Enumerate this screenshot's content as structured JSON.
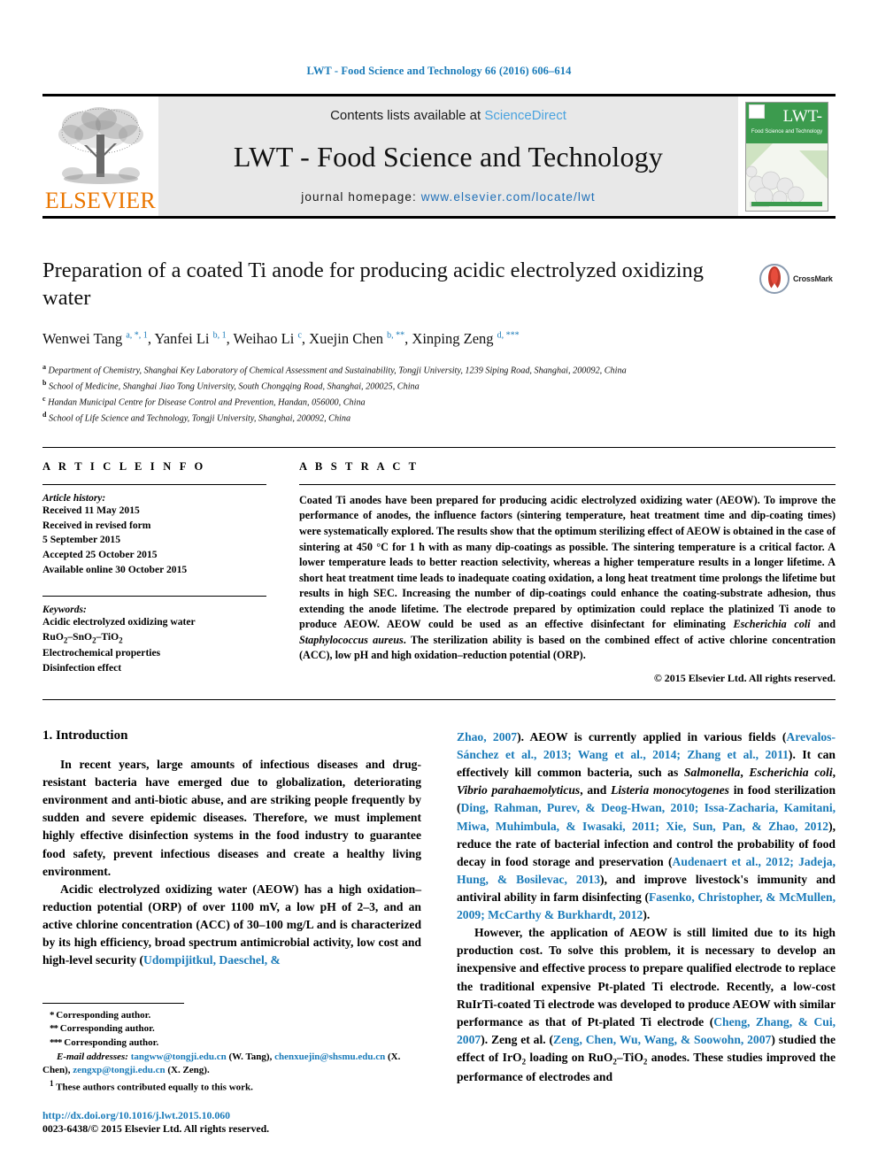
{
  "running_head": "LWT - Food Science and Technology 66 (2016) 606–614",
  "masthead": {
    "publisher_name": "ELSEVIER",
    "contents_prefix": "Contents lists available at ",
    "sciencedirect": "ScienceDirect",
    "journal_title": "LWT - Food Science and Technology",
    "homepage_prefix": "journal homepage: ",
    "homepage_url": "www.elsevier.com/locate/lwt",
    "cover": {
      "title": "LWT-",
      "subtitle": "Food Science and Technology"
    },
    "colors": {
      "link": "#2070b8",
      "sciencedirect": "#4aa3df",
      "elsevier_orange": "#ea7600",
      "band_grey": "#e8e8e8",
      "cover_green": "#3c9b4e"
    }
  },
  "article": {
    "title": "Preparation of a coated Ti anode for producing acidic electrolyzed oxidizing water",
    "crossmark_label": "CrossMark",
    "authors_html": "Wenwei Tang <sup>a, *, 1</sup>, Yanfei Li <sup>b, 1</sup>, Weihao Li <sup>c</sup>, Xuejin Chen <sup>b, **</sup>, Xinping Zeng <sup>d, ***</sup>",
    "affiliations": [
      {
        "mark": "a",
        "text": "Department of Chemistry, Shanghai Key Laboratory of Chemical Assessment and Sustainability, Tongji University, 1239 Siping Road, Shanghai, 200092, China"
      },
      {
        "mark": "b",
        "text": "School of Medicine, Shanghai Jiao Tong University, South Chongqing Road, Shanghai, 200025, China"
      },
      {
        "mark": "c",
        "text": "Handan Municipal Centre for Disease Control and Prevention, Handan, 056000, China"
      },
      {
        "mark": "d",
        "text": "School of Life Science and Technology, Tongji University, Shanghai, 200092, China"
      }
    ]
  },
  "article_info": {
    "heading": "A R T I C L E  I N F O",
    "history_label": "Article history:",
    "history": [
      "Received 11 May 2015",
      "Received in revised form",
      "5 September 2015",
      "Accepted 25 October 2015",
      "Available online 30 October 2015"
    ],
    "keywords_label": "Keywords:",
    "keywords_html": [
      "Acidic electrolyzed oxidizing water",
      "RuO<sub>2</sub>–SnO<sub>2</sub>–TiO<sub>2</sub>",
      "Electrochemical properties",
      "Disinfection effect"
    ]
  },
  "abstract": {
    "heading": "A B S T R A C T",
    "body_html": "Coated Ti anodes have been prepared for producing acidic electrolyzed oxidizing water (AEOW). To improve the performance of anodes, the influence factors (sintering temperature, heat treatment time and dip-coating times) were systematically explored. The results show that the optimum sterilizing effect of AEOW is obtained in the case of sintering at 450 °C for 1 h with as many dip-coatings as possible. The sintering temperature is a critical factor. A lower temperature leads to better reaction selectivity, whereas a higher temperature results in a longer lifetime. A short heat treatment time leads to inadequate coating oxidation, a long heat treatment time prolongs the lifetime but results in high SEC. Increasing the number of dip-coatings could enhance the coating-substrate adhesion, thus extending the anode lifetime. The electrode prepared by optimization could replace the platinized Ti anode to produce AEOW. AEOW could be used as an effective disinfectant for eliminating <i>Escherichia coli</i> and <i>Staphylococcus aureus</i>. The sterilization ability is based on the combined effect of active chlorine concentration (ACC), low pH and high oxidation–reduction potential (ORP).",
    "copyright": "© 2015 Elsevier Ltd. All rights reserved."
  },
  "introduction": {
    "heading": "1.  Introduction",
    "left_paragraphs_html": [
      "In recent years, large amounts of infectious diseases and drug-resistant bacteria have emerged due to globalization, deteriorating environment and anti-biotic abuse, and are striking people frequently by sudden and severe epidemic diseases. Therefore, we must implement highly effective disinfection systems in the food industry to guarantee food safety, prevent infectious diseases and create a healthy living environment.",
      "Acidic electrolyzed oxidizing water (AEOW) has a high oxidation–reduction potential (ORP) of over 1100 mV, a low pH of 2–3, and an active chlorine concentration (ACC) of 30–100 mg/L and is characterized by its high efficiency, broad spectrum antimicrobial activity, low cost and high-level security (<span class=\"ref\">Udompijitkul, Daeschel, &amp;</span>"
    ],
    "right_paragraphs_html": [
      "<span class=\"ref\">Zhao, 2007</span>). AEOW is currently applied in various fields (<span class=\"ref\">Arevalos-Sánchez et al., 2013; Wang et al., 2014; Zhang et al., 2011</span>). It can effectively kill common bacteria, such as <i>Salmonella</i>, <i>Escherichia coli</i>, <i>Vibrio parahaemolyticus</i>, and <i>Listeria monocytogenes</i> in food sterilization (<span class=\"ref\">Ding, Rahman, Purev, &amp; Deog-Hwan, 2010; Issa-Zacharia, Kamitani, Miwa, Muhimbula, &amp; Iwasaki, 2011; Xie, Sun, Pan, &amp; Zhao, 2012</span>), reduce the rate of bacterial infection and control the probability of food decay in food storage and preservation (<span class=\"ref\">Audenaert et al., 2012; Jadeja, Hung, &amp; Bosilevac, 2013</span>), and improve livestock's immunity and antiviral ability in farm disinfecting (<span class=\"ref\">Fasenko, Christopher, &amp; McMullen, 2009; McCarthy &amp; Burkhardt, 2012</span>).",
      "However, the application of AEOW is still limited due to its high production cost. To solve this problem, it is necessary to develop an inexpensive and effective process to prepare qualified electrode to replace the traditional expensive Pt-plated Ti electrode. Recently, a low-cost RuIrTi-coated Ti electrode was developed to produce AEOW with similar performance as that of Pt-plated Ti electrode (<span class=\"ref\">Cheng, Zhang, &amp; Cui, 2007</span>). Zeng et al. (<span class=\"ref\">Zeng, Chen, Wu, Wang, &amp; Soowohn, 2007</span>) studied the effect of IrO<sub>2</sub> loading on RuO<sub>2</sub>–TiO<sub>2</sub> anodes. These studies improved the performance of electrodes and"
    ]
  },
  "footnotes": {
    "lines_html": [
      "<span class=\"star\">*</span> Corresponding author.",
      "<span class=\"star\">**</span> Corresponding author.",
      "<span class=\"star\">***</span> Corresponding author."
    ],
    "email_html": "<span class=\"fn-email\">E-mail addresses:</span> <span class=\"fn-link\">tangww@tongji.edu.cn</span> (W. Tang), <span class=\"fn-link\">chenxuejin@shsmu.edu.cn</span> (X. Chen), <span class=\"fn-link\">zengxp@tongji.edu.cn</span> (X. Zeng).",
    "equal_contrib_html": "<sup>1</sup>  These authors contributed equally to this work.",
    "doi": "http://dx.doi.org/10.1016/j.lwt.2015.10.060",
    "issn_html": "0023-6438/© 2015 Elsevier Ltd. All rights reserved."
  }
}
